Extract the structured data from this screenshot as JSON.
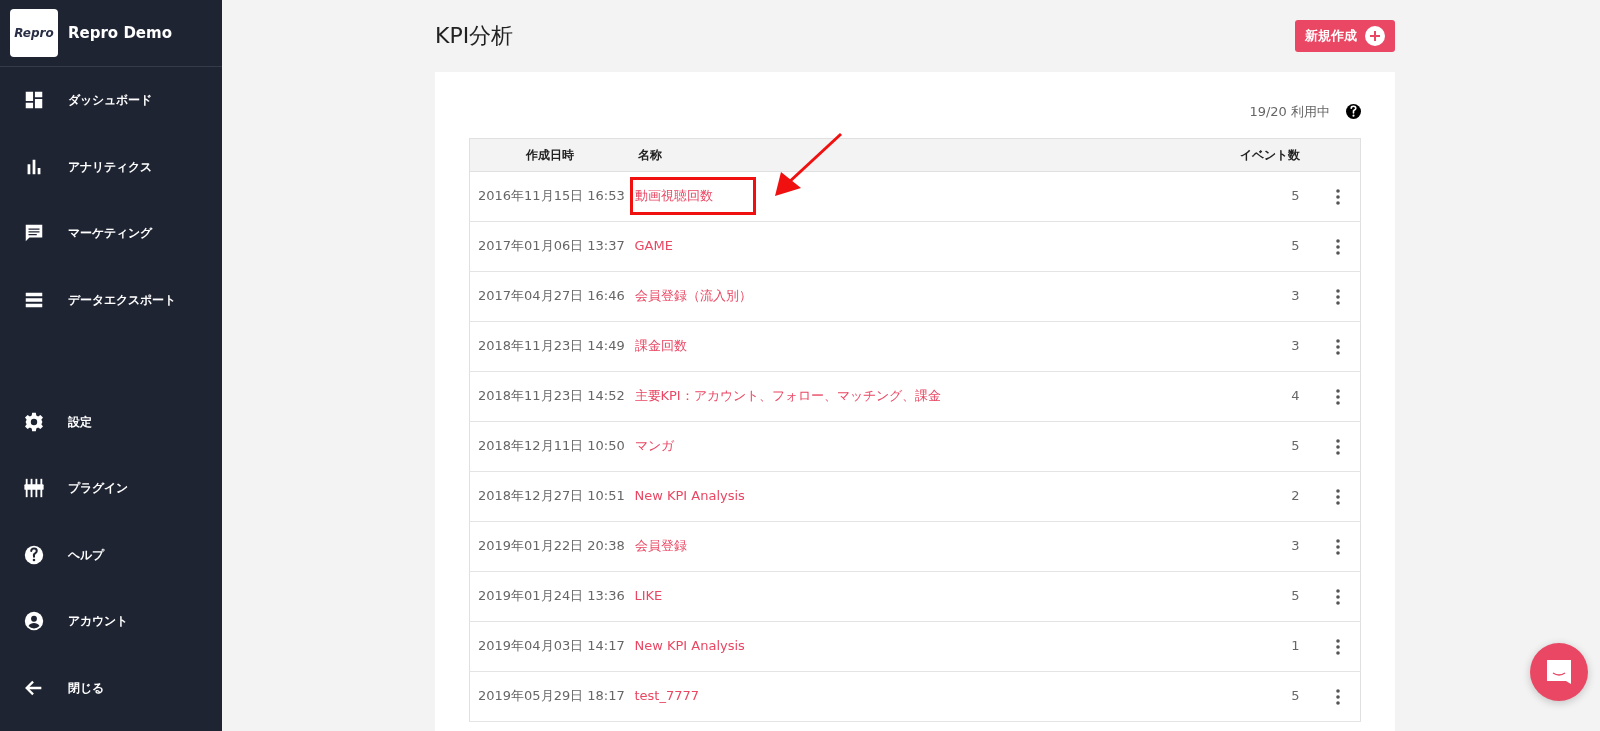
{
  "sidebar": {
    "brand": {
      "logo": "Repro",
      "title": "Repro Demo"
    },
    "items": [
      {
        "label": "ダッシュボード"
      },
      {
        "label": "アナリティクス"
      },
      {
        "label": "マーケティング"
      },
      {
        "label": "データエクスポート"
      }
    ],
    "bottom_items": [
      {
        "label": "設定"
      },
      {
        "label": "プラグイン"
      },
      {
        "label": "ヘルプ"
      },
      {
        "label": "アカウント"
      },
      {
        "label": "閉じる"
      }
    ]
  },
  "page": {
    "title": "KPI分析",
    "new_button": "新規作成",
    "usage": "19/20 利用中"
  },
  "table": {
    "columns": [
      "作成日時",
      "名称",
      "イベント数"
    ],
    "rows": [
      {
        "created": "2016年11月15日 16:53",
        "name": "動画視聴回数",
        "events": "5",
        "highlighted": true
      },
      {
        "created": "2017年01月06日 13:37",
        "name": "GAME",
        "events": "5",
        "highlighted": false
      },
      {
        "created": "2017年04月27日 16:46",
        "name": "会員登録（流入別）",
        "events": "3",
        "highlighted": false
      },
      {
        "created": "2018年11月23日 14:49",
        "name": "課金回数",
        "events": "3",
        "highlighted": false
      },
      {
        "created": "2018年11月23日 14:52",
        "name": "主要KPI：アカウント、フォロー、マッチング、課金",
        "events": "4",
        "highlighted": false
      },
      {
        "created": "2018年12月11日 10:50",
        "name": "マンガ",
        "events": "5",
        "highlighted": false
      },
      {
        "created": "2018年12月27日 10:51",
        "name": "New KPI Analysis",
        "events": "2",
        "highlighted": false
      },
      {
        "created": "2019年01月22日 20:38",
        "name": "会員登録",
        "events": "3",
        "highlighted": false
      },
      {
        "created": "2019年01月24日 13:36",
        "name": "LIKE",
        "events": "5",
        "highlighted": false
      },
      {
        "created": "2019年04月03日 14:17",
        "name": "New KPI Analysis",
        "events": "1",
        "highlighted": false
      },
      {
        "created": "2019年05月29日 18:17",
        "name": "test_7777",
        "events": "5",
        "highlighted": false
      }
    ]
  }
}
